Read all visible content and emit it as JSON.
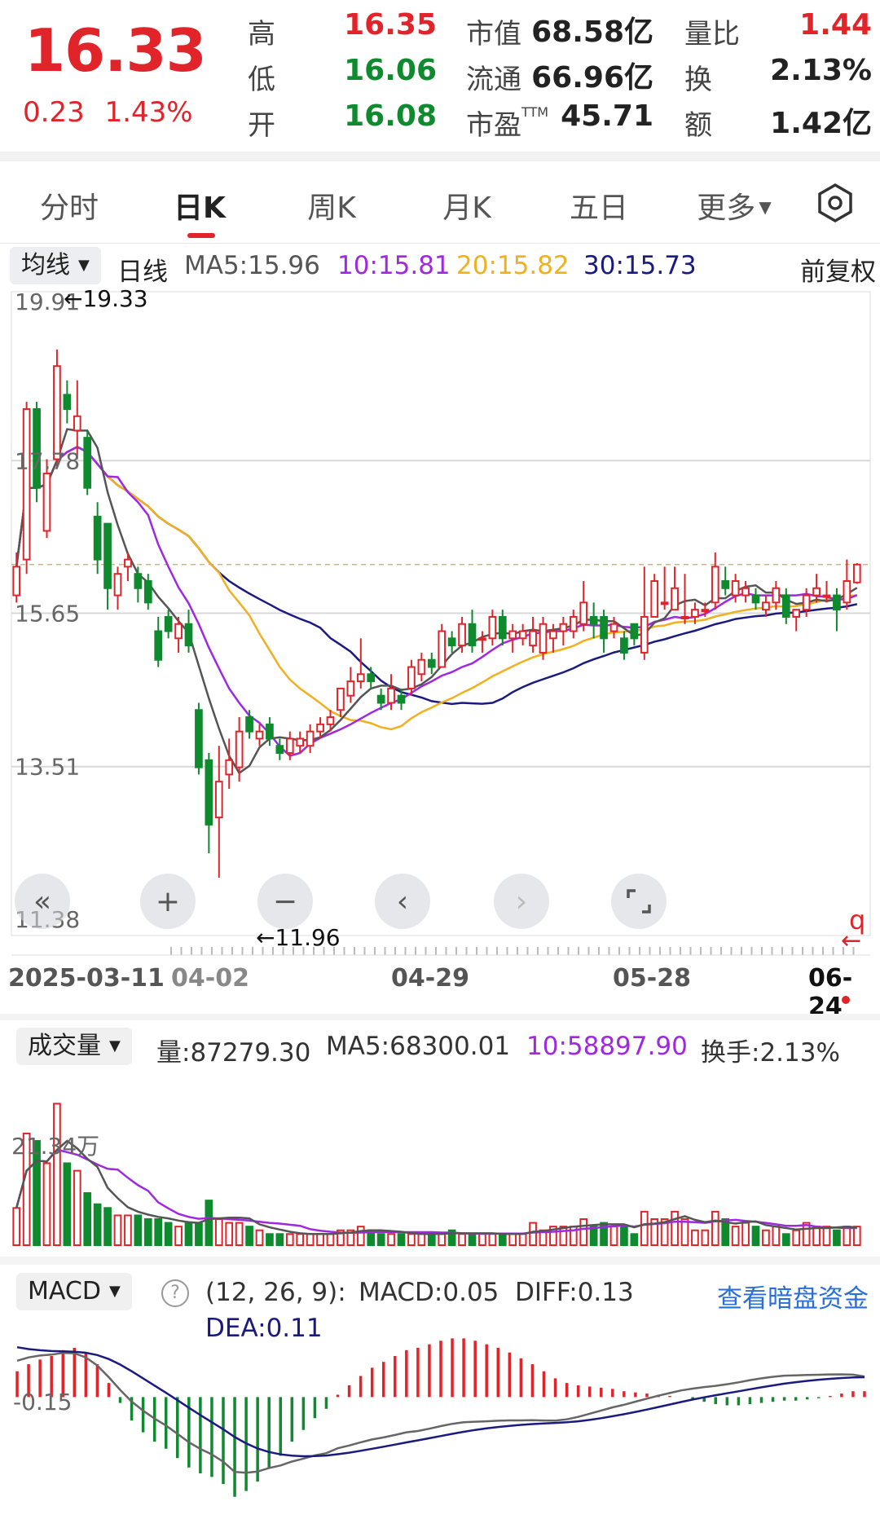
{
  "quote": {
    "price": "16.33",
    "change": "0.23",
    "change_pct": "1.43%",
    "high_label": "高",
    "high": "16.35",
    "low_label": "低",
    "low": "16.06",
    "open_label": "开",
    "open": "16.08",
    "mktcap_label": "市值",
    "mktcap": "68.58亿",
    "float_label": "流通",
    "float": "66.96亿",
    "pe_label": "市盈",
    "pe_sup": "TTM",
    "pe": "45.71",
    "volratio_label": "量比",
    "volratio": "1.44",
    "turnover_label": "换",
    "turnover": "2.13%",
    "amount_label": "额",
    "amount": "1.42亿"
  },
  "tabs": [
    "分时",
    "日K",
    "周K",
    "月K",
    "五日",
    "更多"
  ],
  "active_tab": "日K",
  "ma_legend": {
    "dropdown": "均线",
    "period": "日线",
    "ma5": "MA5:15.96",
    "ma10": "10:15.81",
    "ma20": "20:15.82",
    "ma30": "30:15.73",
    "adjust": "前复权"
  },
  "colors": {
    "up": "#e0242a",
    "down": "#0f8a2e",
    "ma5": "#555555",
    "ma10": "#a028e0",
    "ma20": "#f0b020",
    "ma30": "#1a1a80",
    "link": "#2a6fd8"
  },
  "y_axis": [
    "19.91",
    "17.78",
    "15.65",
    "13.51",
    "11.38"
  ],
  "high_marker": "←19.33",
  "low_marker": "←11.96",
  "dates": [
    "2025-03-11",
    "04-02",
    "04-29",
    "05-28",
    "06-24"
  ],
  "controls": [
    "double-left",
    "zoom-in",
    "zoom-out",
    "prev",
    "next",
    "fullscreen"
  ],
  "volume_legend": {
    "dropdown": "成交量",
    "vol": "量:87279.30",
    "ma5": "MA5:68300.01",
    "ma10": "10:58897.90",
    "turnover": "换手:2.13%",
    "axis": "21.34万"
  },
  "macd_legend": {
    "dropdown": "MACD",
    "params": "(12, 26, 9):",
    "macd": "MACD:0.05",
    "diff": "DIFF:0.13",
    "dea": "DEA:0.11",
    "link": "查看暗盘资金",
    "axis": "-0.15"
  },
  "chart_data": {
    "type": "candlestick",
    "title": "",
    "ylim": [
      11.38,
      19.91
    ],
    "candles": [
      {
        "o": 15.9,
        "h": 16.5,
        "l": 15.8,
        "c": 16.3
      },
      {
        "o": 16.4,
        "h": 18.6,
        "l": 16.2,
        "c": 18.5
      },
      {
        "o": 18.5,
        "h": 18.6,
        "l": 17.2,
        "c": 17.4
      },
      {
        "o": 16.8,
        "h": 17.8,
        "l": 16.7,
        "c": 17.6
      },
      {
        "o": 17.8,
        "h": 19.33,
        "l": 17.7,
        "c": 19.1
      },
      {
        "o": 18.7,
        "h": 18.9,
        "l": 18.3,
        "c": 18.5
      },
      {
        "o": 18.2,
        "h": 18.9,
        "l": 17.8,
        "c": 18.4
      },
      {
        "o": 18.1,
        "h": 18.2,
        "l": 17.3,
        "c": 17.4
      },
      {
        "o": 17.0,
        "h": 17.2,
        "l": 16.2,
        "c": 16.4
      },
      {
        "o": 16.9,
        "h": 16.9,
        "l": 15.7,
        "c": 16.0
      },
      {
        "o": 15.9,
        "h": 16.3,
        "l": 15.7,
        "c": 16.2
      },
      {
        "o": 16.3,
        "h": 16.5,
        "l": 16.1,
        "c": 16.4
      },
      {
        "o": 16.2,
        "h": 16.3,
        "l": 15.8,
        "c": 16.0
      },
      {
        "o": 16.1,
        "h": 16.2,
        "l": 15.7,
        "c": 15.8
      },
      {
        "o": 15.4,
        "h": 15.6,
        "l": 14.9,
        "c": 15.0
      },
      {
        "o": 15.6,
        "h": 15.7,
        "l": 15.3,
        "c": 15.4
      },
      {
        "o": 15.3,
        "h": 15.6,
        "l": 15.1,
        "c": 15.5
      },
      {
        "o": 15.5,
        "h": 15.7,
        "l": 15.1,
        "c": 15.2
      },
      {
        "o": 14.3,
        "h": 14.4,
        "l": 13.4,
        "c": 13.5
      },
      {
        "o": 13.6,
        "h": 13.7,
        "l": 12.3,
        "c": 12.7
      },
      {
        "o": 12.8,
        "h": 13.8,
        "l": 11.96,
        "c": 13.3
      },
      {
        "o": 13.4,
        "h": 13.9,
        "l": 13.2,
        "c": 13.6
      },
      {
        "o": 13.5,
        "h": 14.2,
        "l": 13.3,
        "c": 14.0
      },
      {
        "o": 14.2,
        "h": 14.3,
        "l": 13.9,
        "c": 14.0
      },
      {
        "o": 13.9,
        "h": 14.1,
        "l": 13.8,
        "c": 14.0
      },
      {
        "o": 14.1,
        "h": 14.2,
        "l": 13.8,
        "c": 13.9
      },
      {
        "o": 13.8,
        "h": 13.9,
        "l": 13.6,
        "c": 13.7
      },
      {
        "o": 13.7,
        "h": 14.0,
        "l": 13.6,
        "c": 13.9
      },
      {
        "o": 13.8,
        "h": 14.0,
        "l": 13.7,
        "c": 13.9
      },
      {
        "o": 13.8,
        "h": 14.1,
        "l": 13.7,
        "c": 14.0
      },
      {
        "o": 14.0,
        "h": 14.2,
        "l": 13.9,
        "c": 14.1
      },
      {
        "o": 14.1,
        "h": 14.3,
        "l": 14.0,
        "c": 14.2
      },
      {
        "o": 14.3,
        "h": 14.6,
        "l": 14.2,
        "c": 14.6
      },
      {
        "o": 14.5,
        "h": 14.9,
        "l": 14.4,
        "c": 14.7
      },
      {
        "o": 14.7,
        "h": 15.3,
        "l": 14.6,
        "c": 14.8
      },
      {
        "o": 14.8,
        "h": 14.9,
        "l": 14.6,
        "c": 14.7
      },
      {
        "o": 14.5,
        "h": 14.6,
        "l": 14.3,
        "c": 14.4
      },
      {
        "o": 14.4,
        "h": 14.8,
        "l": 14.3,
        "c": 14.6
      },
      {
        "o": 14.5,
        "h": 14.6,
        "l": 14.3,
        "c": 14.4
      },
      {
        "o": 14.6,
        "h": 15.0,
        "l": 14.5,
        "c": 14.9
      },
      {
        "o": 14.8,
        "h": 15.1,
        "l": 14.7,
        "c": 15.0
      },
      {
        "o": 15.0,
        "h": 15.1,
        "l": 14.8,
        "c": 14.9
      },
      {
        "o": 14.9,
        "h": 15.5,
        "l": 14.9,
        "c": 15.4
      },
      {
        "o": 15.3,
        "h": 15.4,
        "l": 15.1,
        "c": 15.2
      },
      {
        "o": 15.2,
        "h": 15.6,
        "l": 15.1,
        "c": 15.5
      },
      {
        "o": 15.5,
        "h": 15.7,
        "l": 15.1,
        "c": 15.2
      },
      {
        "o": 15.3,
        "h": 15.4,
        "l": 15.1,
        "c": 15.3
      },
      {
        "o": 15.3,
        "h": 15.7,
        "l": 15.2,
        "c": 15.6
      },
      {
        "o": 15.6,
        "h": 15.7,
        "l": 15.2,
        "c": 15.3
      },
      {
        "o": 15.3,
        "h": 15.5,
        "l": 15.1,
        "c": 15.4
      },
      {
        "o": 15.3,
        "h": 15.5,
        "l": 15.2,
        "c": 15.4
      },
      {
        "o": 15.2,
        "h": 15.6,
        "l": 15.1,
        "c": 15.4
      },
      {
        "o": 15.1,
        "h": 15.6,
        "l": 15.0,
        "c": 15.5
      },
      {
        "o": 15.3,
        "h": 15.5,
        "l": 15.1,
        "c": 15.4
      },
      {
        "o": 15.4,
        "h": 15.6,
        "l": 15.2,
        "c": 15.5
      },
      {
        "o": 15.4,
        "h": 15.7,
        "l": 15.3,
        "c": 15.6
      },
      {
        "o": 15.5,
        "h": 16.1,
        "l": 15.4,
        "c": 15.8
      },
      {
        "o": 15.6,
        "h": 15.8,
        "l": 15.3,
        "c": 15.5
      },
      {
        "o": 15.6,
        "h": 15.7,
        "l": 15.1,
        "c": 15.3
      },
      {
        "o": 15.4,
        "h": 15.6,
        "l": 15.3,
        "c": 15.5
      },
      {
        "o": 15.3,
        "h": 15.4,
        "l": 15.0,
        "c": 15.1
      },
      {
        "o": 15.5,
        "h": 15.5,
        "l": 15.2,
        "c": 15.3
      },
      {
        "o": 15.1,
        "h": 16.3,
        "l": 15.0,
        "c": 15.6
      },
      {
        "o": 15.6,
        "h": 16.2,
        "l": 15.6,
        "c": 16.1
      },
      {
        "o": 15.8,
        "h": 16.3,
        "l": 15.7,
        "c": 15.8
      },
      {
        "o": 15.7,
        "h": 16.3,
        "l": 15.7,
        "c": 16.0
      },
      {
        "o": 15.6,
        "h": 16.2,
        "l": 15.5,
        "c": 15.6
      },
      {
        "o": 15.6,
        "h": 15.8,
        "l": 15.5,
        "c": 15.7
      },
      {
        "o": 15.7,
        "h": 15.8,
        "l": 15.6,
        "c": 15.7
      },
      {
        "o": 15.8,
        "h": 16.5,
        "l": 15.7,
        "c": 16.3
      },
      {
        "o": 16.1,
        "h": 16.3,
        "l": 15.9,
        "c": 16.0
      },
      {
        "o": 15.9,
        "h": 16.2,
        "l": 15.8,
        "c": 16.1
      },
      {
        "o": 15.9,
        "h": 16.1,
        "l": 15.8,
        "c": 16.0
      },
      {
        "o": 15.9,
        "h": 16.0,
        "l": 15.7,
        "c": 15.8
      },
      {
        "o": 15.7,
        "h": 15.9,
        "l": 15.6,
        "c": 15.8
      },
      {
        "o": 15.8,
        "h": 16.1,
        "l": 15.7,
        "c": 16.0
      },
      {
        "o": 15.9,
        "h": 16.0,
        "l": 15.5,
        "c": 15.6
      },
      {
        "o": 15.6,
        "h": 15.7,
        "l": 15.4,
        "c": 15.7
      },
      {
        "o": 15.7,
        "h": 16.0,
        "l": 15.6,
        "c": 15.9
      },
      {
        "o": 15.9,
        "h": 16.2,
        "l": 15.8,
        "c": 16.0
      },
      {
        "o": 15.9,
        "h": 16.1,
        "l": 15.8,
        "c": 15.9
      },
      {
        "o": 15.9,
        "h": 16.0,
        "l": 15.4,
        "c": 15.7
      },
      {
        "o": 15.8,
        "h": 16.4,
        "l": 15.7,
        "c": 16.1
      },
      {
        "o": 16.08,
        "h": 16.35,
        "l": 16.06,
        "c": 16.33
      }
    ],
    "volume_max": 21.34,
    "volumes": [
      5,
      15,
      14,
      11,
      19,
      11,
      10,
      7,
      5.5,
      5,
      4,
      4,
      4,
      3.5,
      3.5,
      3,
      2.5,
      3,
      3,
      6,
      3.5,
      3,
      3,
      2.5,
      2,
      1.5,
      1.5,
      1.5,
      1.5,
      1.5,
      1.5,
      1.5,
      2,
      2,
      2.5,
      2,
      1.5,
      1.5,
      1.5,
      1.5,
      1.5,
      1.5,
      1.5,
      2,
      1.5,
      1.5,
      1.5,
      1.5,
      1.5,
      1.5,
      1.5,
      3,
      2,
      2.5,
      2.5,
      2.5,
      3.5,
      2.5,
      3,
      2.5,
      2.5,
      1.5,
      4.5,
      3.5,
      3.5,
      4.5,
      3.5,
      2,
      2,
      4.5,
      3.5,
      2.5,
      3,
      2.5,
      2,
      2.5,
      1.5,
      2,
      3,
      2.5,
      2.5,
      2,
      2.5,
      2.5
    ],
    "macd_hist": [
      0.22,
      0.28,
      0.32,
      0.35,
      0.4,
      0.42,
      0.38,
      0.28,
      0.12,
      -0.05,
      -0.2,
      -0.3,
      -0.38,
      -0.44,
      -0.52,
      -0.6,
      -0.65,
      -0.68,
      -0.74,
      -0.85,
      -0.8,
      -0.72,
      -0.6,
      -0.5,
      -0.38,
      -0.28,
      -0.18,
      -0.1,
      0.02,
      0.1,
      0.18,
      0.25,
      0.3,
      0.35,
      0.4,
      0.42,
      0.45,
      0.48,
      0.5,
      0.5,
      0.48,
      0.45,
      0.42,
      0.38,
      0.33,
      0.28,
      0.22,
      0.16,
      0.12,
      0.1,
      0.09,
      0.08,
      0.07,
      0.05,
      0.04,
      0.03,
      0.02,
      0.01,
      0.0,
      -0.02,
      -0.04,
      -0.06,
      -0.07,
      -0.07,
      -0.06,
      -0.05,
      -0.04,
      -0.03,
      -0.03,
      -0.02,
      -0.01,
      0.01,
      0.03,
      0.05,
      0.05
    ],
    "macd_ylim": [
      -0.9,
      0.6
    ]
  }
}
